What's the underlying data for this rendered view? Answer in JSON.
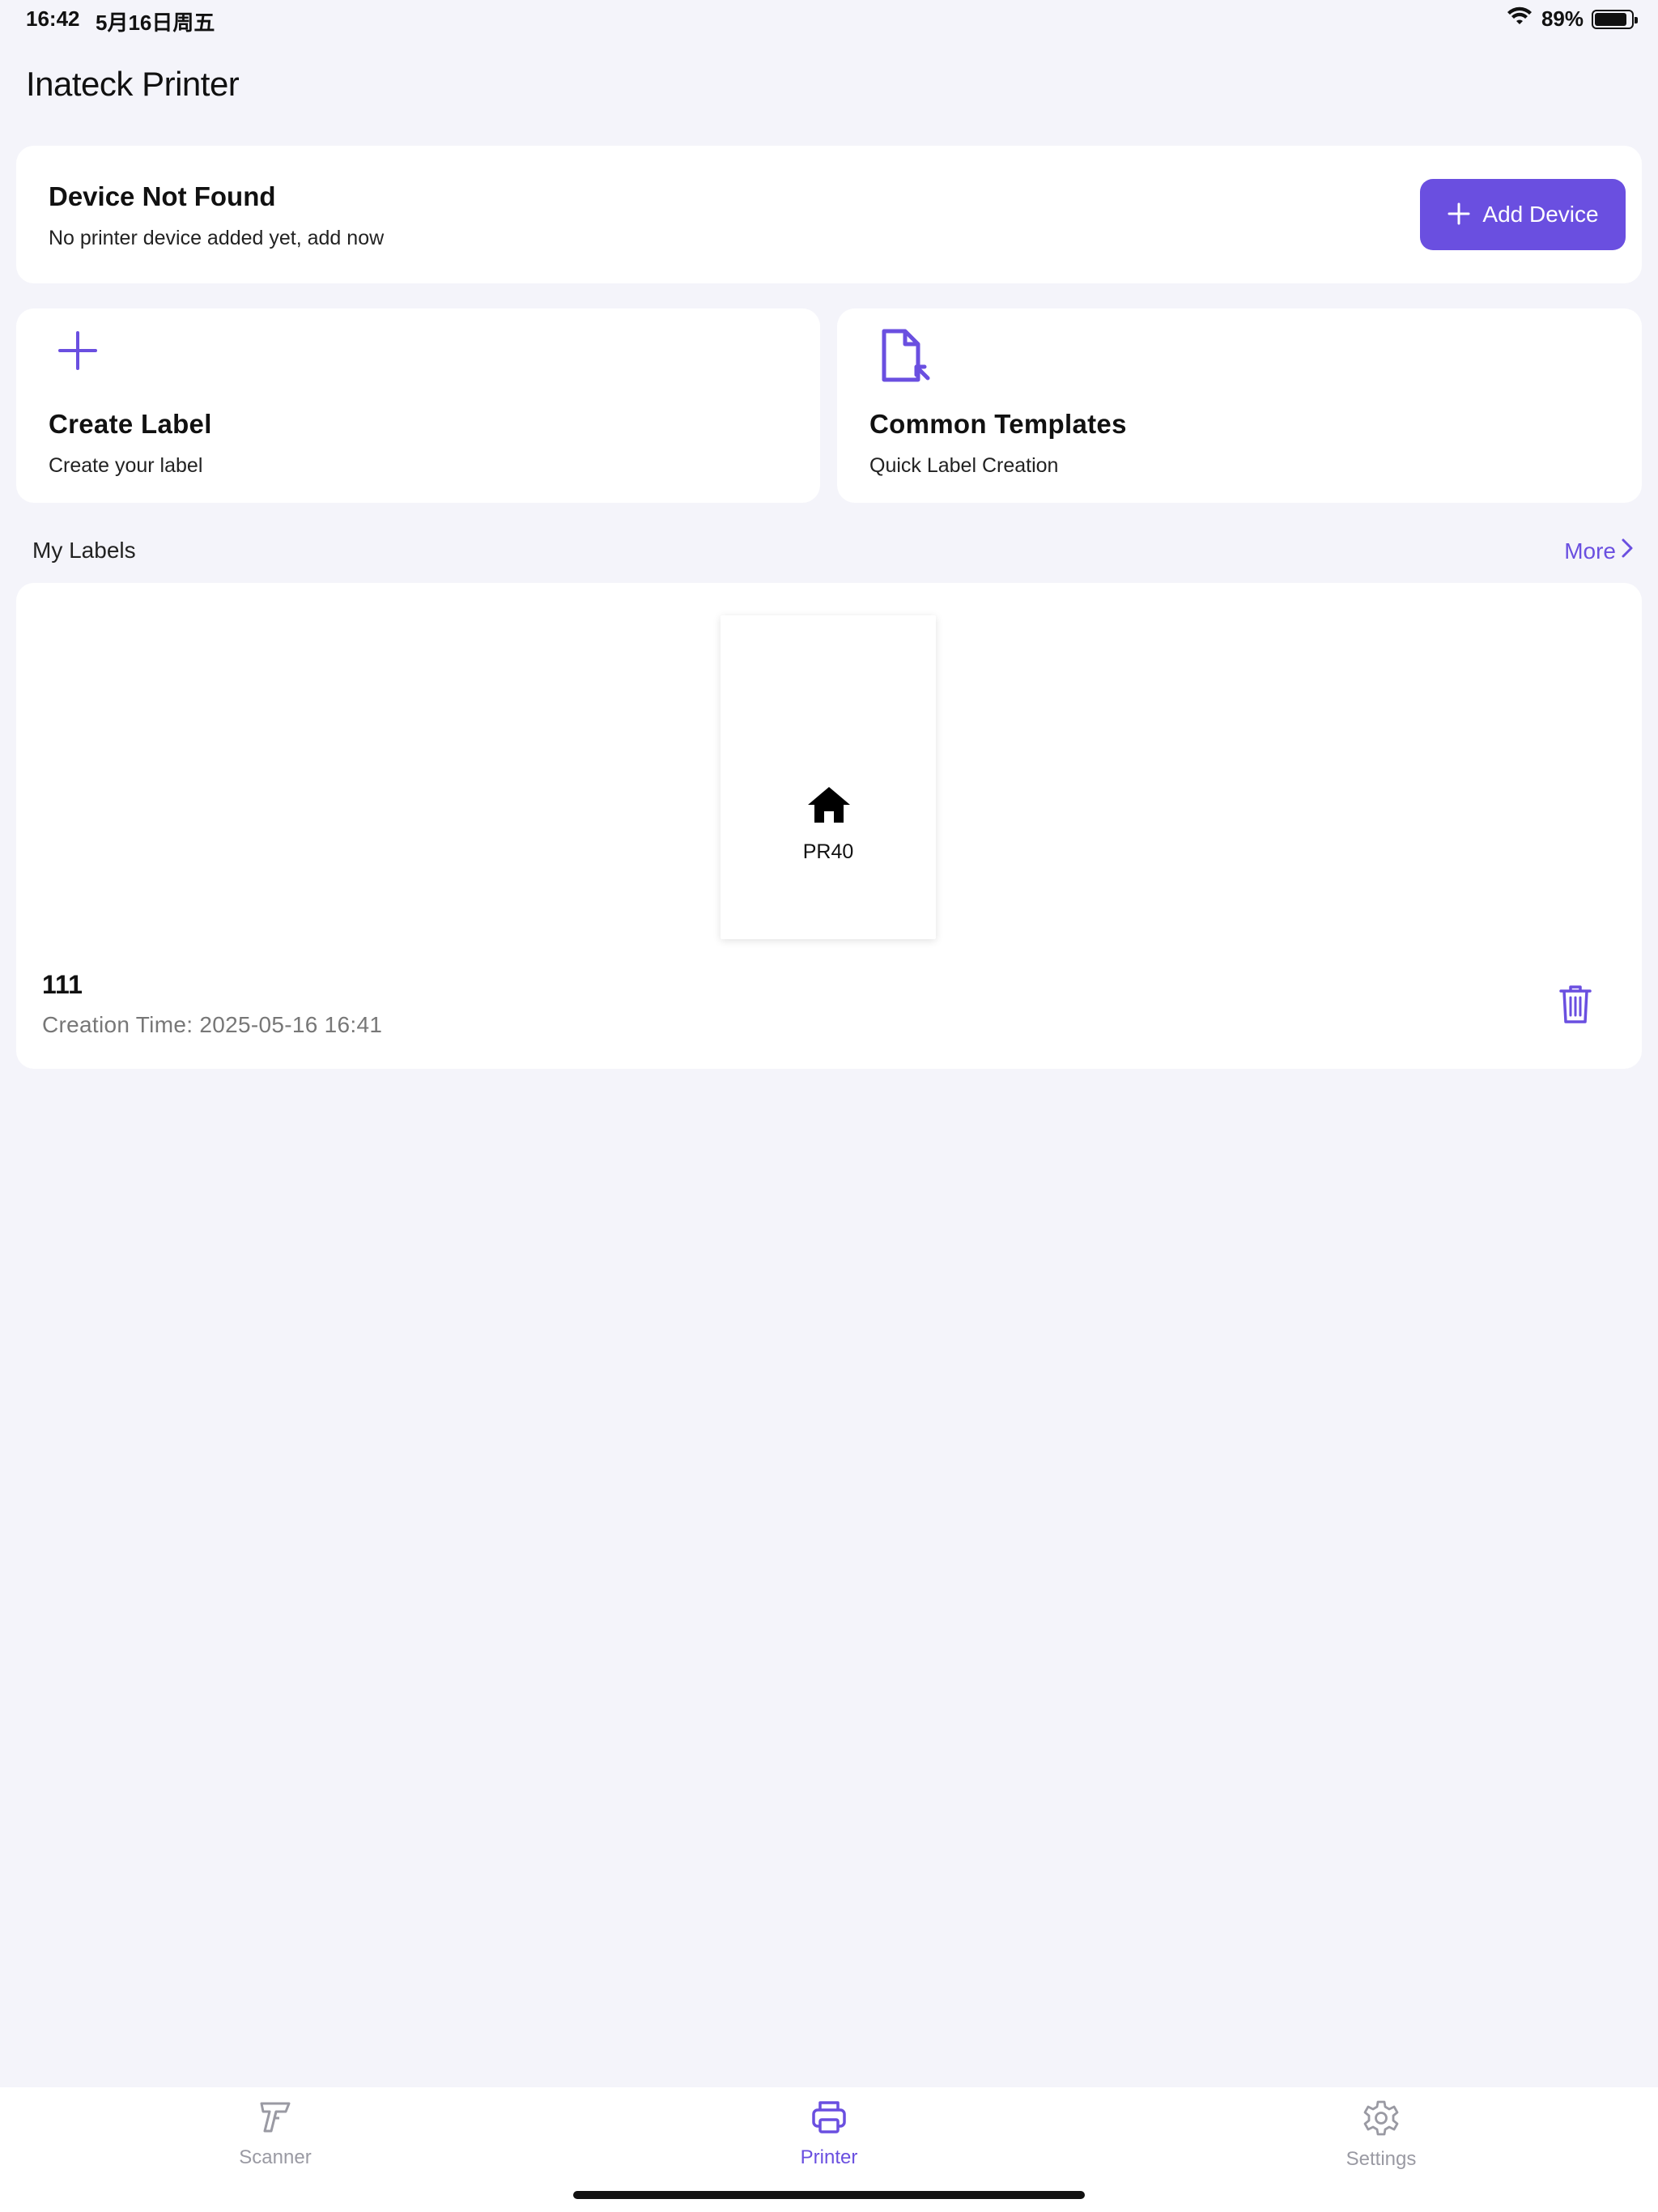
{
  "status_bar": {
    "time": "16:42",
    "date": "5月16日周五",
    "battery_percent": "89%",
    "battery_level": 0.89,
    "wifi_icon": "wifi-icon",
    "battery_icon": "battery-icon"
  },
  "app": {
    "title": "Inateck Printer"
  },
  "device": {
    "title": "Device Not Found",
    "subtitle": "No printer device added yet, add now",
    "add_button_label": "Add Device",
    "add_icon": "plus-icon"
  },
  "actions": {
    "create": {
      "title": "Create Label",
      "subtitle": "Create your label",
      "icon": "plus-icon"
    },
    "templates": {
      "title": "Common Templates",
      "subtitle": "Quick Label Creation",
      "icon": "document-arrow-icon"
    }
  },
  "my_labels": {
    "section_title": "My Labels",
    "more_label": "More",
    "items": [
      {
        "name": "111",
        "creation_time": "Creation Time: 2025-05-16 16:41",
        "thumbnail_text": "PR40",
        "thumbnail_icon": "home-icon"
      }
    ]
  },
  "tabs": [
    {
      "label": "Scanner",
      "icon": "scanner-icon",
      "active": false
    },
    {
      "label": "Printer",
      "icon": "printer-icon",
      "active": true
    },
    {
      "label": "Settings",
      "icon": "gear-icon",
      "active": false
    }
  ],
  "colors": {
    "accent": "#6a4fe0",
    "background": "#f4f4fa",
    "card": "#ffffff",
    "muted": "#9a9aa3"
  }
}
